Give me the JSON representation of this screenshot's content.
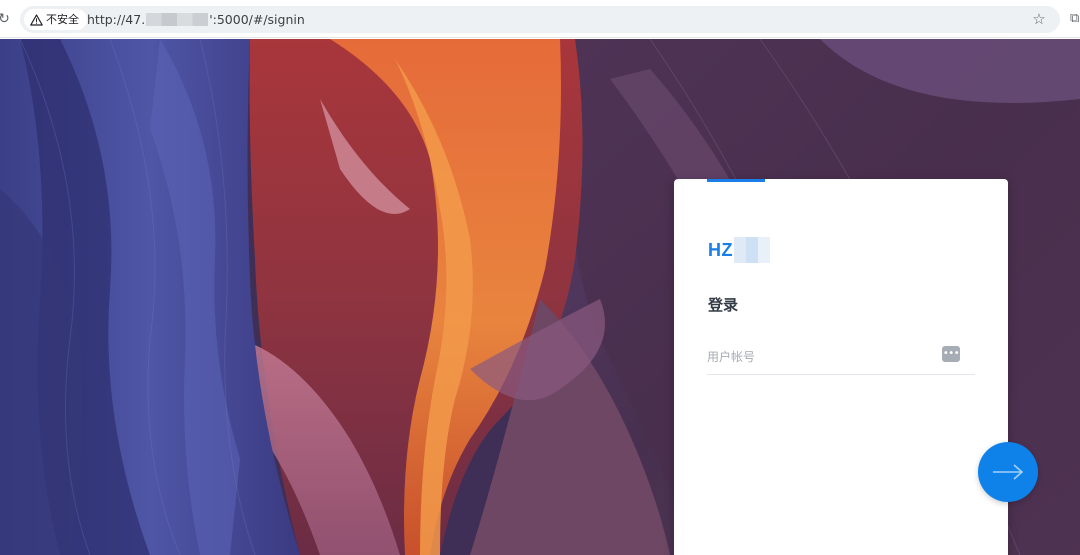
{
  "browser": {
    "security_label": "不安全",
    "url_prefix": "http://47.",
    "url_suffix": "':5000/#/signin",
    "icons": {
      "reload": "reload-icon",
      "warning": "warning-icon",
      "bookmark": "star-icon",
      "extension": "extension-icon"
    }
  },
  "card": {
    "brand": "HZ",
    "title": "登录",
    "account_placeholder": "用户帐号",
    "account_value": "",
    "accent_color": "#1a7ee8"
  },
  "submit": {
    "icon": "arrow-right-icon",
    "color": "#0f82ea"
  },
  "colors": {
    "brand": "#1a7ee8",
    "title": "#333b45",
    "placeholder": "#a6abb2"
  }
}
